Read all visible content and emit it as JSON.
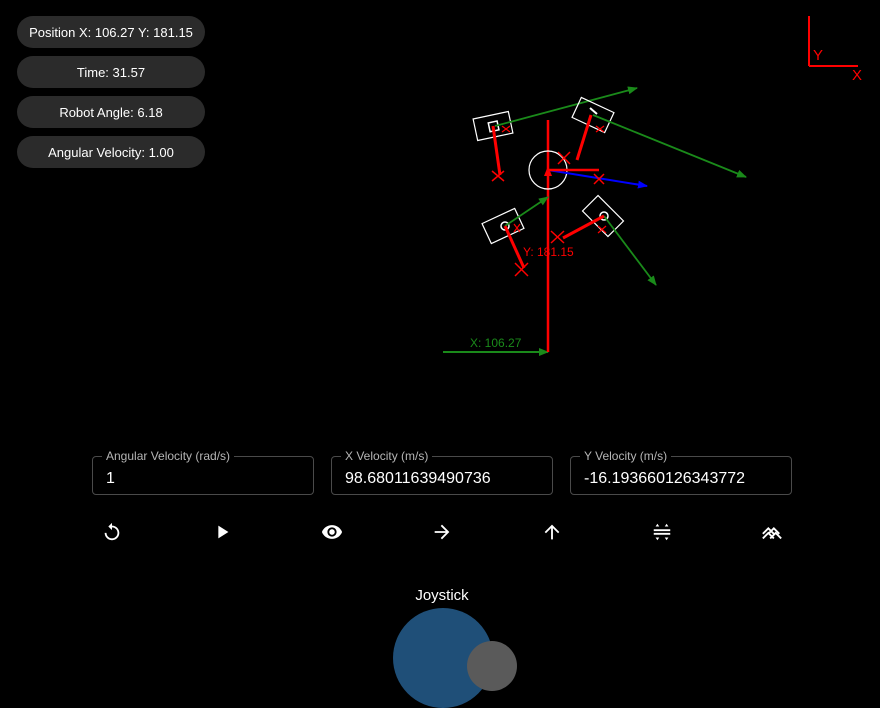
{
  "status": {
    "position": "Position X: 106.27 Y: 181.15",
    "time": "Time: 31.57",
    "robot_angle": "Robot Angle: 6.18",
    "angular_velocity": "Angular Velocity: 1.00"
  },
  "axes_indicator": {
    "y_label": "Y",
    "x_label": "X",
    "color": "#ff0000"
  },
  "scene": {
    "x_label": "X: 106.27",
    "y_label": "Y: 181.15",
    "x_color": "#1a8a1a",
    "y_color": "#ff0000",
    "velocity_color": "#0000ff"
  },
  "inputs": {
    "angular": {
      "label": "Angular Velocity (rad/s)",
      "value": "1"
    },
    "x_velocity": {
      "label": "X Velocity (m/s)",
      "value": "98.68011639490736"
    },
    "y_velocity": {
      "label": "Y Velocity (m/s)",
      "value": "-16.193660126343772"
    }
  },
  "toolbar": {
    "buttons": [
      {
        "icon": "reset-icon"
      },
      {
        "icon": "play-icon"
      },
      {
        "icon": "eye-icon"
      },
      {
        "icon": "arrow-right-icon"
      },
      {
        "icon": "arrow-up-icon"
      },
      {
        "icon": "swap-vertical-icon"
      },
      {
        "icon": "stacked-chevrons-icon"
      }
    ]
  },
  "joystick": {
    "label": "Joystick"
  }
}
